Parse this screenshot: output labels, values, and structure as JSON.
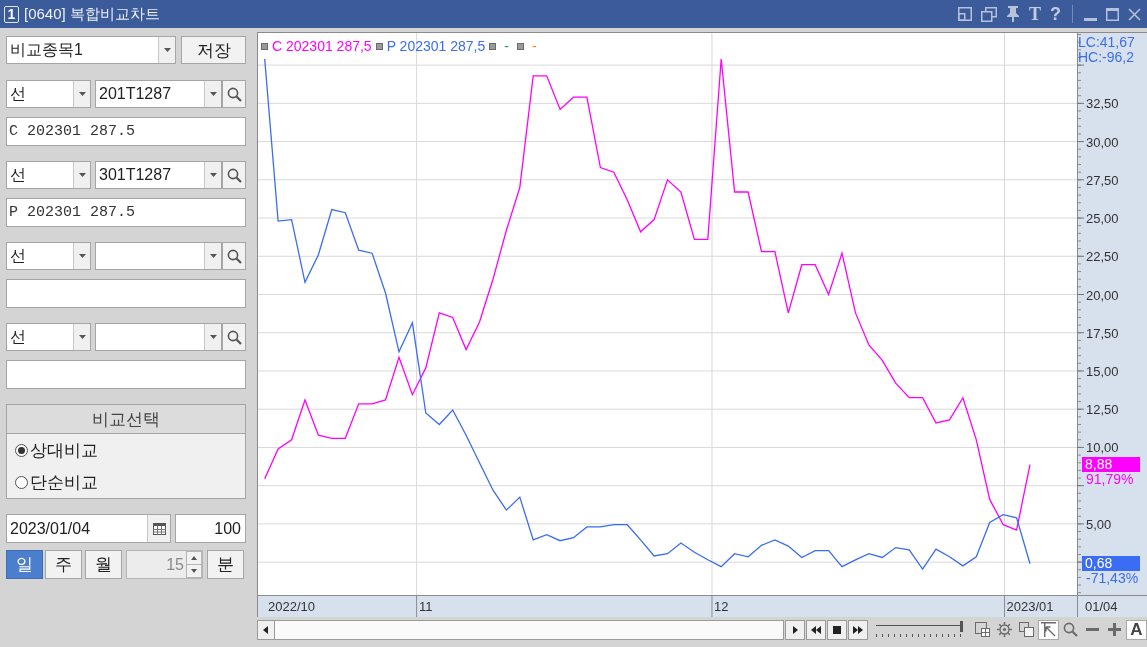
{
  "window": {
    "number": "1",
    "title": "[0640] 복합비교차트",
    "tool_glyphs": [
      "T",
      "?"
    ]
  },
  "panel": {
    "preset": "비교종목1",
    "save_label": "저장",
    "slots": [
      {
        "style": "선",
        "code": "201T1287",
        "title": "C 202301 287.5"
      },
      {
        "style": "선",
        "code": "301T1287",
        "title": "P 202301 287.5"
      },
      {
        "style": "선"
      },
      {
        "style": "선"
      }
    ],
    "compare": {
      "title": "비교선택",
      "options": [
        {
          "label": "상대비교",
          "selected": true
        },
        {
          "label": "단순비교",
          "selected": false
        }
      ]
    },
    "date": "2023/01/04",
    "count": "100",
    "periods": [
      {
        "label": "일",
        "selected": true
      },
      {
        "label": "주",
        "selected": false
      },
      {
        "label": "월",
        "selected": false
      }
    ],
    "minute": {
      "value": "15",
      "disabled": true
    },
    "minute_label": "분"
  },
  "chart": {
    "legend_placeholders": [
      {
        "label": "-",
        "color": "#22a04b"
      },
      {
        "label": "-",
        "color": "#ff7f27"
      }
    ],
    "stats": [
      "LC:41,67",
      "HC:-96,2"
    ],
    "value_tags": [
      {
        "value": "8,88",
        "change": "91,79%"
      },
      {
        "value": "0,68",
        "change": "-71,43%"
      }
    ],
    "corner_label": "01/04",
    "chart_data": [
      {
        "type": "line",
        "categories": [
          null,
          null,
          "2022/10",
          null,
          null,
          null,
          null,
          null,
          null,
          null,
          null,
          null,
          "11",
          null,
          null,
          null,
          null,
          null,
          null,
          null,
          null,
          null,
          null,
          null,
          null,
          null,
          null,
          null,
          null,
          null,
          null,
          null,
          null,
          null,
          "12",
          null,
          null,
          null,
          null,
          null,
          null,
          null,
          null,
          null,
          null,
          null,
          null,
          null,
          null,
          null,
          null,
          null,
          null,
          null,
          null,
          null,
          null,
          "2023/01"
        ],
        "series": [
          {
            "name": "C 202301 287,5",
            "color": "#ff00ff",
            "values": [
              7.95,
              9.9,
              10.5,
              13.1,
              10.8,
              10.6,
              10.6,
              12.85,
              12.85,
              13.1,
              15.9,
              13.45,
              15.2,
              18.8,
              18.5,
              16.4,
              18.2,
              21.0,
              24.2,
              27.0,
              34.3,
              34.3,
              32.1,
              32.9,
              32.9,
              28.3,
              28.0,
              26.2,
              24.1,
              24.9,
              27.5,
              26.7,
              23.6,
              23.6,
              35.4,
              26.7,
              26.7,
              22.8,
              22.8,
              18.8,
              21.95,
              21.95,
              20.0,
              22.7,
              18.8,
              16.7,
              15.7,
              14.2,
              13.25,
              13.25,
              11.6,
              11.8,
              13.25,
              10.5,
              6.6,
              4.95,
              4.6,
              8.88
            ]
          },
          {
            "name": "P 202301 287,5",
            "color": "#3a6cf4",
            "values": [
              35.4,
              24.8,
              24.9,
              20.8,
              22.6,
              25.55,
              25.35,
              22.9,
              22.7,
              20.1,
              16.25,
              18.15,
              12.25,
              11.5,
              12.45,
              10.8,
              9.0,
              7.2,
              5.9,
              6.75,
              3.95,
              4.3,
              3.9,
              4.1,
              4.8,
              4.8,
              4.95,
              4.95,
              3.95,
              2.9,
              3.05,
              3.75,
              3.15,
              2.65,
              2.2,
              3.05,
              2.85,
              3.6,
              3.95,
              3.55,
              2.8,
              3.25,
              3.25,
              2.2,
              2.65,
              3.05,
              2.8,
              3.45,
              3.3,
              2.05,
              3.35,
              2.85,
              2.25,
              2.85,
              5.1,
              5.6,
              5.4,
              2.4
            ]
          }
        ],
        "ylim": [
          0.35,
          37.1
        ],
        "yticks": [
          {
            "value": 5,
            "label": "5,00"
          },
          {
            "value": 10,
            "label": "10,00"
          },
          {
            "value": 12.5,
            "label": "12,50"
          },
          {
            "value": 15,
            "label": "15,00"
          },
          {
            "value": 17.5,
            "label": "17,50"
          },
          {
            "value": 20,
            "label": "20,00"
          },
          {
            "value": 22.5,
            "label": "22,50"
          },
          {
            "value": 25,
            "label": "25,00"
          },
          {
            "value": 27.5,
            "label": "27,50"
          },
          {
            "value": 30,
            "label": "30,00"
          },
          {
            "value": 32.5,
            "label": "32,50"
          }
        ],
        "grid": true
      }
    ]
  },
  "toolbar": {
    "zoom_slider": {
      "level": 1
    },
    "tools": [
      {
        "kind": "icon",
        "pressed": false
      },
      {
        "kind": "icon",
        "pressed": false
      },
      {
        "kind": "icon",
        "pressed": false
      },
      {
        "kind": "icon",
        "pressed": true
      },
      {
        "kind": "icon",
        "pressed": false
      },
      {
        "kind": "icon",
        "pressed": false
      },
      {
        "kind": "icon",
        "pressed": false
      },
      {
        "kind": "text",
        "label": "A",
        "pressed": true
      }
    ]
  }
}
